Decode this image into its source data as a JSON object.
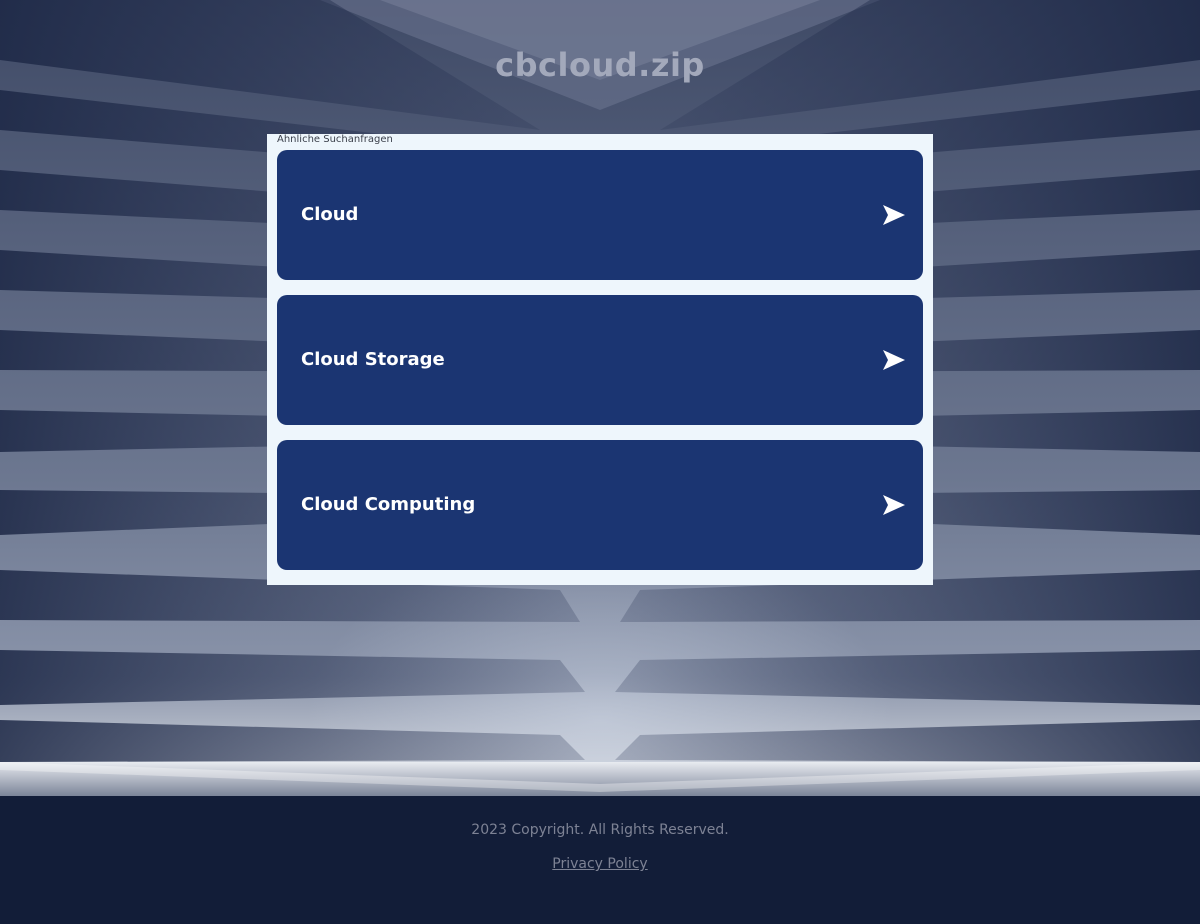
{
  "site": {
    "title": "cbcloud.zip"
  },
  "related": {
    "label": "Ähnliche Suchanfragen",
    "items": [
      {
        "label": "Cloud"
      },
      {
        "label": "Cloud Storage"
      },
      {
        "label": "Cloud Computing"
      }
    ]
  },
  "footer": {
    "copyright": "2023 Copyright. All Rights Reserved.",
    "privacy_label": "Privacy Policy "
  },
  "colors": {
    "card_background": "#1b3572",
    "panel_background": "#eef6fc",
    "footer_background": "#121d38"
  }
}
